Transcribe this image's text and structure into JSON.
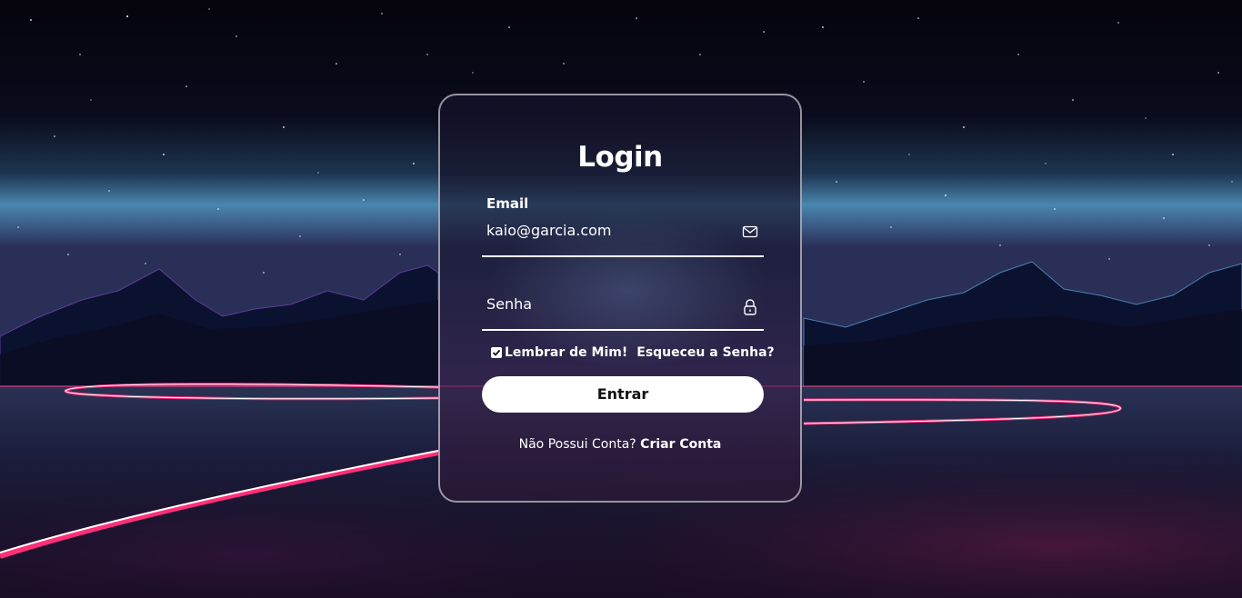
{
  "login": {
    "title": "Login",
    "email": {
      "label": "Email",
      "value": "kaio@garcia.com",
      "icon": "mail-icon"
    },
    "password": {
      "placeholder": "Senha",
      "icon": "lock-icon"
    },
    "remember_label": "Lembrar de Mim!",
    "remember_checked": true,
    "forgot_label": "Esqueceu a Senha?",
    "submit_label": "Entrar",
    "signup_prompt": "Não Possui Conta?",
    "signup_link": "Criar Conta"
  },
  "colors": {
    "sky_top": "#05040c",
    "horizon_glow": "#4a86b0",
    "neon_pink": "#ff2f7a",
    "card_border": "#b9b6c8",
    "button_bg": "#ffffff",
    "button_text": "#111111"
  }
}
